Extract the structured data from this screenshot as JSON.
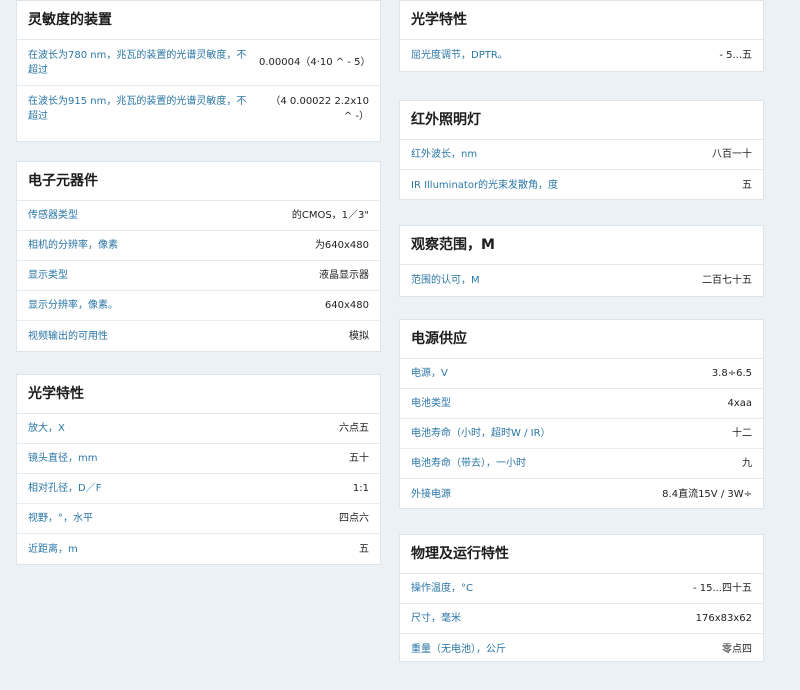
{
  "left": {
    "sensitivity": {
      "title": "灵敏度的装置",
      "rows": [
        {
          "label": "在波长为780 nm，兆瓦的装置的光谱灵敏度，不超过",
          "value": "0.00004（4·10 ^ - 5）"
        },
        {
          "label": "在波长为915 nm，兆瓦的装置的光谱灵敏度，不超过",
          "value": "（4 0.00022 2.2x10 ^ -）"
        }
      ]
    },
    "electronics": {
      "title": "电子元器件",
      "rows": [
        {
          "label": "传感器类型",
          "value": "的CMOS，1／3\""
        },
        {
          "label": "相机的分辨率，像素",
          "value": "为640x480"
        },
        {
          "label": "显示类型",
          "value": "液晶显示器"
        },
        {
          "label": "显示分辨率，像素。",
          "value": "640x480"
        },
        {
          "label": "视频输出的可用性",
          "value": "模拟"
        }
      ]
    },
    "optics": {
      "title": "光学特性",
      "rows": [
        {
          "label": "放大，X",
          "value": "六点五"
        },
        {
          "label": "镜头直径，mm",
          "value": "五十"
        },
        {
          "label": "相对孔径，D／F",
          "value": "1:1"
        },
        {
          "label": "视野，°，水平",
          "value": "四点六"
        },
        {
          "label": "近距离，m",
          "value": "五"
        }
      ]
    }
  },
  "right": {
    "optics2": {
      "title": "光学特性",
      "rows": [
        {
          "label": "屈光度调节，DPTR。",
          "value": "- 5...五"
        }
      ]
    },
    "ir": {
      "title": "红外照明灯",
      "rows": [
        {
          "label": "红外波长，nm",
          "value": "八百一十"
        },
        {
          "label": "IR Illuminator的光束发散角，度",
          "value": "五"
        }
      ]
    },
    "range": {
      "title": "观察范围，M",
      "rows": [
        {
          "label": "范围的认可，M",
          "value": "二百七十五"
        }
      ]
    },
    "power": {
      "title": "电源供应",
      "rows": [
        {
          "label": "电源，V",
          "value": "3.8÷6.5"
        },
        {
          "label": "电池类型",
          "value": "4xaa"
        },
        {
          "label": "电池寿命（小时，超时W / IR）",
          "value": "十二"
        },
        {
          "label": "电池寿命（带去），一小时",
          "value": "九"
        },
        {
          "label": "外接电源",
          "value": "8.4直流15V / 3W÷"
        }
      ]
    },
    "physical": {
      "title": "物理及运行特性",
      "rows": [
        {
          "label": "操作温度，°C",
          "value": "- 15...四十五"
        },
        {
          "label": "尺寸，毫米",
          "value": "176x83x62"
        },
        {
          "label": "重量（无电池），公斤",
          "value": "零点四"
        }
      ]
    }
  }
}
